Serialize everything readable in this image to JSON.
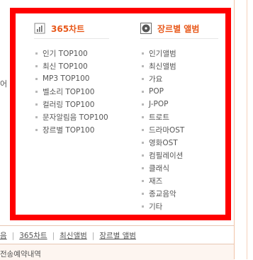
{
  "background": {
    "edge_left_text": "어"
  },
  "chart_menu": {
    "title": "365차트",
    "icon": "chart-bars-icon",
    "items": [
      "인기 TOP100",
      "최신 TOP100",
      "MP3 TOP100",
      "벨소리 TOP100",
      "컬러링 TOP100",
      "문자알림음 TOP100",
      "장르별 TOP100"
    ]
  },
  "album_menu": {
    "title": "장르별 앨범",
    "icon": "disc-icon",
    "items": [
      "인기앨범",
      "최신앨범",
      "가요",
      "POP",
      "J-POP",
      "트로트",
      "드라마OST",
      "영화OST",
      "컴필레이션",
      "클래식",
      "재즈",
      "종교음악",
      "기타"
    ]
  },
  "bottom_nav": {
    "links": [
      "음",
      "365차트",
      "최신앨범",
      "장르별 앨범"
    ]
  },
  "bottom_row": {
    "text": "전송예약내역"
  },
  "colors": {
    "accent": "#e8581a",
    "highlight_border": "#ff0000",
    "text": "#555555",
    "bullet": "#b8b8b8"
  }
}
